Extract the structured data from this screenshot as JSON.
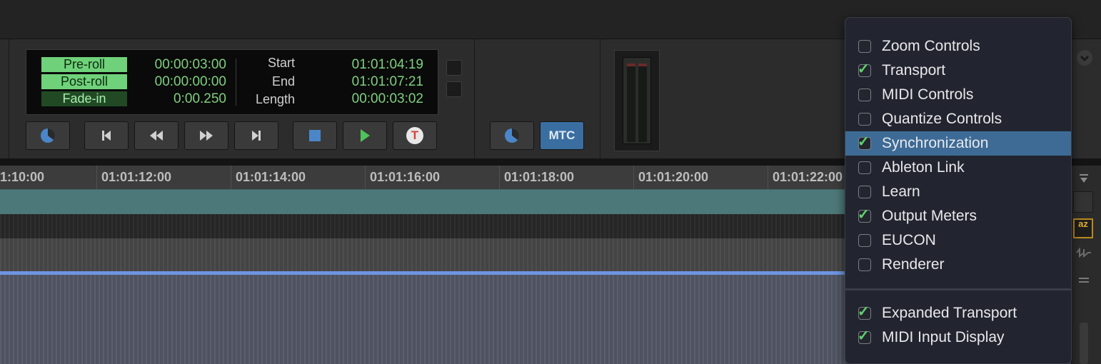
{
  "counter": {
    "preroll_label": "Pre-roll",
    "preroll_value": "00:00:03:00",
    "postroll_label": "Post-roll",
    "postroll_value": "00:00:00:00",
    "fadein_label": "Fade-in",
    "fadein_value": "0:00.250",
    "start_label": "Start",
    "start_value": "01:01:04:19",
    "end_label": "End",
    "end_value": "01:01:07:21",
    "length_label": "Length",
    "length_value": "00:00:03:02"
  },
  "transport": {
    "mtc_label": "MTC",
    "record_letter": "T"
  },
  "ruler": {
    "ticks": [
      "1:10:00",
      "01:01:12:00",
      "01:01:14:00",
      "01:01:16:00",
      "01:01:18:00",
      "01:01:20:00",
      "01:01:22:00"
    ]
  },
  "side_icons": {
    "az_label": "az"
  },
  "menu": {
    "items": [
      {
        "label": "Zoom Controls",
        "checked": false
      },
      {
        "label": "Transport",
        "checked": true
      },
      {
        "label": "MIDI Controls",
        "checked": false
      },
      {
        "label": "Quantize Controls",
        "checked": false
      },
      {
        "label": "Synchronization",
        "checked": true,
        "highlighted": true
      },
      {
        "label": "Ableton Link",
        "checked": false
      },
      {
        "label": "Learn",
        "checked": false
      },
      {
        "label": "Output Meters",
        "checked": true
      },
      {
        "label": "EUCON",
        "checked": false
      },
      {
        "label": "Renderer",
        "checked": false
      }
    ],
    "extra_items": [
      {
        "label": "Expanded Transport",
        "checked": true
      },
      {
        "label": "MIDI Input Display",
        "checked": true
      }
    ]
  },
  "colors": {
    "counter_green": "#7ed07f",
    "menu_highlight": "#3d6b96",
    "mtc_blue": "#3a6ea1",
    "play_green": "#4fc25a",
    "record_red": "#d6443a"
  }
}
